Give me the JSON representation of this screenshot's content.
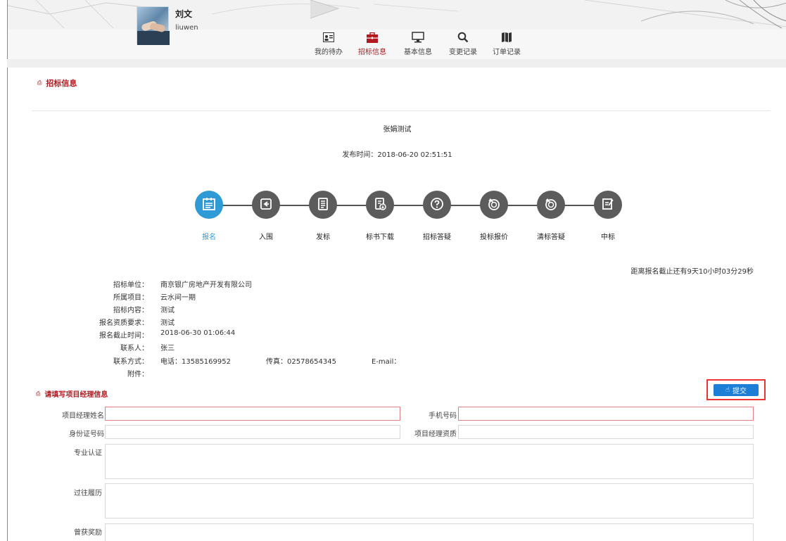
{
  "user": {
    "name": "刘文",
    "login": "liuwen"
  },
  "nav": [
    {
      "label": "我的待办",
      "icon": "contact-card-icon",
      "active": false
    },
    {
      "label": "招标信息",
      "icon": "briefcase-icon",
      "active": true
    },
    {
      "label": "基本信息",
      "icon": "monitor-icon",
      "active": false
    },
    {
      "label": "变更记录",
      "icon": "search-icon",
      "active": false
    },
    {
      "label": "订单记录",
      "icon": "map-icon",
      "active": false
    }
  ],
  "section_title": "招标信息",
  "tender": {
    "title": "张娟测试",
    "publish_time": "发布时间：2018-06-20 02:51:51"
  },
  "steps": [
    {
      "label": "报名",
      "icon": "form-icon",
      "active": true
    },
    {
      "label": "入围",
      "icon": "login-icon",
      "active": false
    },
    {
      "label": "发标",
      "icon": "document-icon",
      "active": false
    },
    {
      "label": "标书下载",
      "icon": "download-doc-icon",
      "active": false
    },
    {
      "label": "招标答疑",
      "icon": "question-icon",
      "active": false
    },
    {
      "label": "投标报价",
      "icon": "timer-icon",
      "active": false
    },
    {
      "label": "清标答疑",
      "icon": "timer-icon",
      "active": false
    },
    {
      "label": "中标",
      "icon": "edit-icon",
      "active": false
    }
  ],
  "countdown": "距离报名截止还有9天10小时03分29秒",
  "details": {
    "unit_label": "招标单位：",
    "unit_value": "南京银广房地产开发有限公司",
    "project_label": "所属项目：",
    "project_value": "云水间一期",
    "content_label": "招标内容：",
    "content_value": "测试",
    "qual_label": "报名资质要求：",
    "qual_value": "测试",
    "deadline_label": "报名截止时间：",
    "deadline_value": "2018-06-30 01:06:44",
    "contact_label": "联系人：",
    "contact_value": "张三",
    "method_label": "联系方式：",
    "phone_value": "电话：13585169952",
    "fax_value": "传真：02578654345",
    "email_value": "E-mail：",
    "attach_label": "附件："
  },
  "pm_section": {
    "title": "请填写项目经理信息",
    "submit_label": "提交",
    "name_label": "项目经理姓名",
    "mobile_label": "手机号码",
    "id_label": "身份证号码",
    "qual_label": "项目经理资质",
    "cert_label": "专业认证",
    "history_label": "过往履历",
    "award_label": "曾获奖励"
  }
}
